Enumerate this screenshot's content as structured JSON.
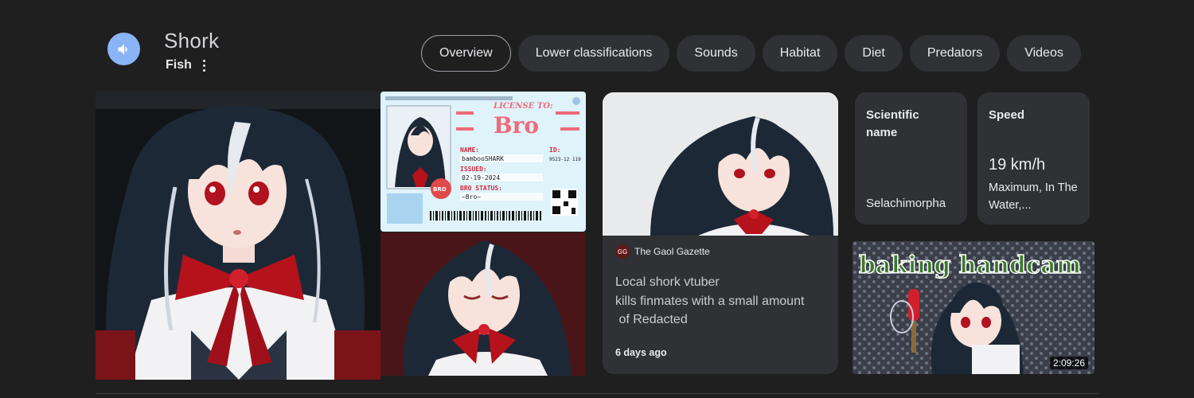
{
  "header": {
    "title": "Shork",
    "subtitle": "Fish",
    "speaker_icon": "speaker-icon",
    "more_icon": "more-vert-icon"
  },
  "tabs": [
    {
      "label": "Overview",
      "active": true
    },
    {
      "label": "Lower classifications",
      "active": false
    },
    {
      "label": "Sounds",
      "active": false
    },
    {
      "label": "Habitat",
      "active": false
    },
    {
      "label": "Diet",
      "active": false
    },
    {
      "label": "Predators",
      "active": false
    },
    {
      "label": "Videos",
      "active": false
    }
  ],
  "license_card": {
    "header": "LICENSE TO:",
    "title": "Bro",
    "name_label": "NAME:",
    "name_value": "bambooSHARK",
    "issued_label": "ISSUED:",
    "issued_value": "02-19-2024",
    "status_label": "BRO STATUS:",
    "status_value": "~Bro~",
    "id_label": "ID:",
    "id_value": "9523-12 119"
  },
  "news": {
    "source_initials": "GG",
    "source": "The Gaol Gazette",
    "headline_lines": [
      "Local shork vtuber",
      "kills finmates with a small amount",
      " of Redacted"
    ],
    "time": "6 days ago"
  },
  "facts": {
    "scientific_name_label": "Scientific name",
    "scientific_name_value": "Selachimorpha",
    "speed_label": "Speed",
    "speed_value": "19 km/h",
    "speed_desc": "Maximum, In The Water,..."
  },
  "video": {
    "title_art": "baking handcam",
    "duration": "2:09:26"
  },
  "colors": {
    "background": "#1f1f1f",
    "chip": "#303134",
    "accent_blue": "#8ab4f8",
    "hair": "#1e2a3a",
    "ribbon_red": "#b5121b"
  }
}
